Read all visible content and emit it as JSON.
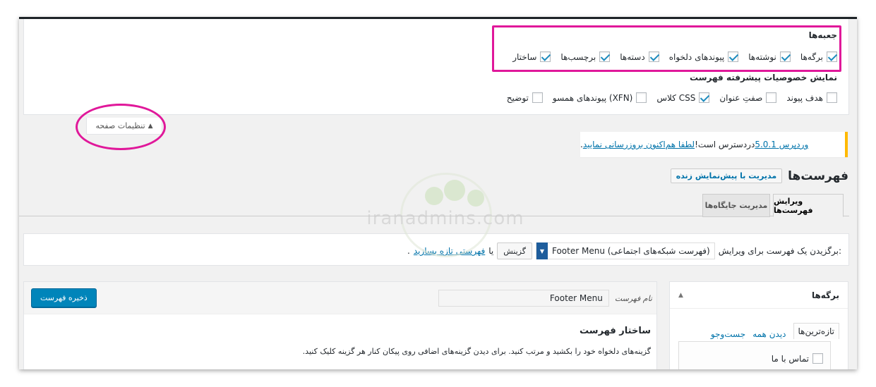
{
  "screen_options": {
    "boxes_title": "جعبه‌ها",
    "boxes": [
      {
        "label": "برگه‌ها",
        "checked": true
      },
      {
        "label": "نوشته‌ها",
        "checked": true
      },
      {
        "label": "پیوندهای دلخواه",
        "checked": true
      },
      {
        "label": "دسته‌ها",
        "checked": true
      },
      {
        "label": "برچسب‌ها",
        "checked": true
      },
      {
        "label": "ساختار",
        "checked": true
      }
    ],
    "advanced_title": "نمایش خصوصیات پیشرفته فهرست",
    "advanced": [
      {
        "label": "هدف پیوند",
        "checked": false
      },
      {
        "label": "صفتِ عنوان",
        "checked": false
      },
      {
        "label": "کلاس CSS",
        "checked": true
      },
      {
        "label": "پیوندهای همسو (XFN)",
        "checked": false
      },
      {
        "label": "توضیح",
        "checked": false
      }
    ],
    "toggle_label": "تنظیمات صفحه",
    "toggle_icon": "triangle-up-icon"
  },
  "notice": {
    "link_version": "وردپرس 5.0.1",
    "text": " دردسترس است! ",
    "link_update": "لطفا هم‌اکنون بروزرسانی نمایید",
    "tail": "."
  },
  "header": {
    "title": "فهرست‌ها",
    "button": "مدیریت با پیش‌نمایش زنده"
  },
  "tabs": [
    {
      "label": "ویرایش فهرست‌ها",
      "active": true
    },
    {
      "label": "مدیریت جایگاه‌ها",
      "active": false
    }
  ],
  "manage": {
    "label": "برگزیدن یک فهرست برای ویرایش:",
    "selected": "Footer Menu (فهرست شبکه‌های اجتماعی)",
    "select_button": "گزینش",
    "or": "یا",
    "create_link": "فهرستی تازه بسازید",
    "tail": "."
  },
  "pages_panel": {
    "title": "برگه‌ها",
    "tabs": [
      "تازه‌ترین‌ها",
      "دیدن همه",
      "جست‌وجو"
    ],
    "items": [
      "تماس با ما"
    ]
  },
  "menu_panel": {
    "save": "ذخیره فهرست",
    "name_label": "نام فهرست",
    "name_value": "Footer Menu",
    "structure_title": "ساختار فهرست",
    "structure_desc": "گزینه‌های دلخواه خود را بکشید و مرتب کنید. برای دیدن گزینه‌های اضافی روی پیکان کنار هر گزینه کلیک کنید."
  },
  "watermark": {
    "text": "iranadmins.com"
  },
  "colors": {
    "accent": "#0073aa",
    "primary_button": "#0085ba",
    "highlight": "#e0189a",
    "notice_border": "#ffb900"
  }
}
